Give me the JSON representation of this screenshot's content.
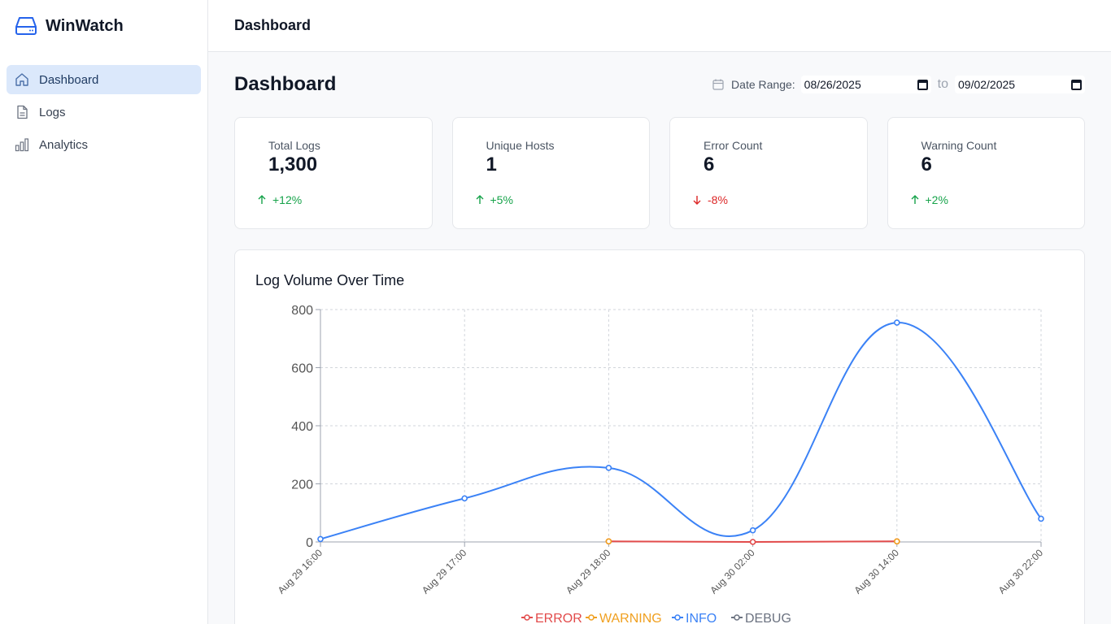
{
  "app": {
    "name": "WinWatch"
  },
  "sidebar": {
    "items": [
      {
        "label": "Dashboard",
        "icon": "home-icon",
        "active": true
      },
      {
        "label": "Logs",
        "icon": "file-icon",
        "active": false
      },
      {
        "label": "Analytics",
        "icon": "bar-chart-icon",
        "active": false
      }
    ]
  },
  "header": {
    "title": "Dashboard"
  },
  "page": {
    "title": "Dashboard",
    "date_range": {
      "label": "Date Range:",
      "from": "08/26/2025",
      "to_word": "to",
      "to": "09/02/2025"
    }
  },
  "stats": [
    {
      "label": "Total Logs",
      "value": "1,300",
      "change": "+12%",
      "trend": "up"
    },
    {
      "label": "Unique Hosts",
      "value": "1",
      "change": "+5%",
      "trend": "up"
    },
    {
      "label": "Error Count",
      "value": "6",
      "change": "-8%",
      "trend": "down"
    },
    {
      "label": "Warning Count",
      "value": "6",
      "change": "+2%",
      "trend": "up"
    }
  ],
  "colors": {
    "accent": "#3b82f6",
    "up": "#16a34a",
    "down": "#dc2626"
  },
  "chart_data": {
    "type": "line",
    "title": "Log Volume Over Time",
    "categories": [
      "Aug 29 16:00",
      "Aug 29 17:00",
      "Aug 29 18:00",
      "Aug 30 02:00",
      "Aug 30 14:00",
      "Aug 30 22:00"
    ],
    "ylim": [
      0,
      800
    ],
    "yticks": [
      0,
      200,
      400,
      600,
      800
    ],
    "grid": true,
    "legend": "bottom",
    "series": [
      {
        "name": "ERROR",
        "color": "#e24b4b",
        "values": [
          null,
          null,
          2,
          0,
          2,
          null
        ]
      },
      {
        "name": "WARNING",
        "color": "#f0a020",
        "values": [
          null,
          null,
          2,
          null,
          2,
          null
        ]
      },
      {
        "name": "INFO",
        "color": "#3b82f6",
        "values": [
          10,
          150,
          255,
          40,
          755,
          80
        ]
      },
      {
        "name": "DEBUG",
        "color": "#6b7280",
        "values": []
      }
    ]
  }
}
